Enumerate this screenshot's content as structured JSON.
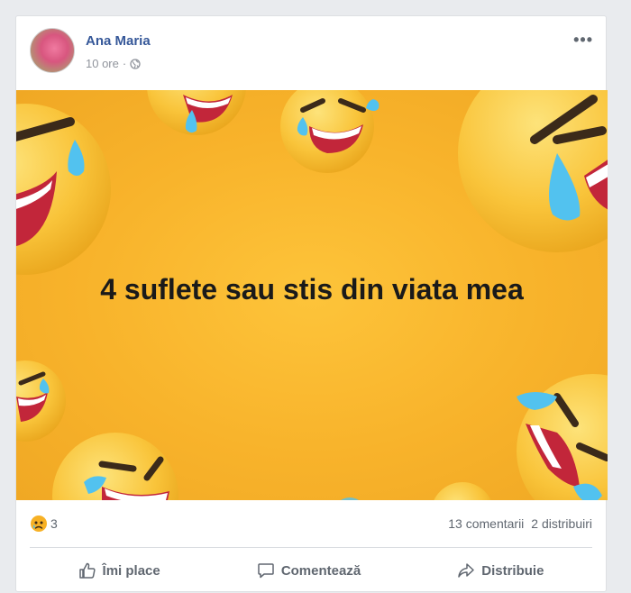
{
  "post": {
    "author": "Ana Maria",
    "time": "10 ore",
    "separator": "·",
    "privacy_icon": "globe-icon",
    "more_icon": "more-options-icon",
    "more_label": "•••",
    "image_text": "4 suflete sau stis din viata mea"
  },
  "stats": {
    "reaction_icon": "sad-reaction-icon",
    "reaction_count": "3",
    "comments": "13 comentarii",
    "shares": "2 distribuiri"
  },
  "actions": {
    "like": "Îmi place",
    "comment": "Comentează",
    "share": "Distribuie"
  },
  "colors": {
    "author": "#365899",
    "background": "#e9ebee",
    "image_yellow": "#f8b32b",
    "muted": "#606770"
  }
}
